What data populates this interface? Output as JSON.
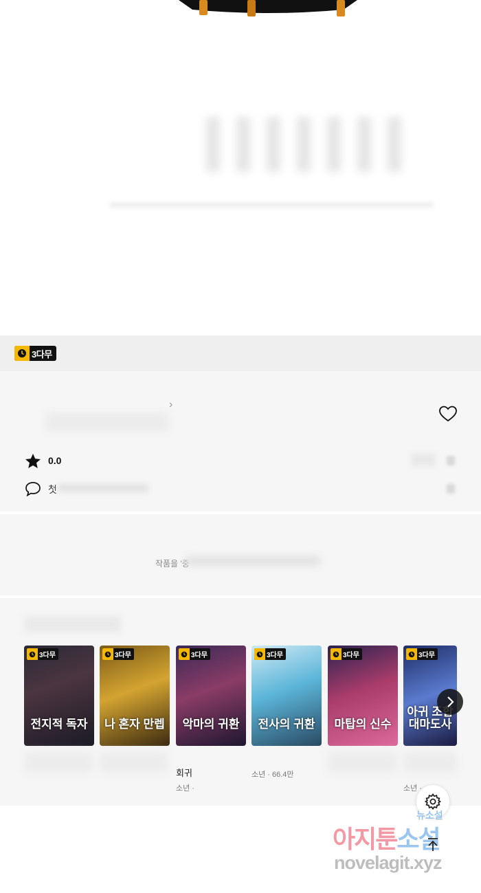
{
  "badge": {
    "label": "3다무",
    "icon": "clock-icon",
    "color": "#f5b800"
  },
  "info": {
    "rating": "0.0",
    "comment_prefix": "첫"
  },
  "works_notice": {
    "text": "작품을 '중"
  },
  "recommendations": {
    "items": [
      {
        "cover_title": "전지적 독자",
        "badge": "3다무"
      },
      {
        "cover_title": "나 혼자 만렙",
        "badge": "3다무"
      },
      {
        "cover_title": "악마의 귀환",
        "badge": "3다무"
      },
      {
        "cover_title": "전사의 귀환",
        "badge": "3다무"
      },
      {
        "cover_title": "마탑의 신수",
        "badge": "3다무"
      },
      {
        "cover_title": "아귀 조합 대마도사",
        "badge": "3다무"
      }
    ],
    "captions": {
      "card3_title": "회귀",
      "card3_meta": "소년 · ",
      "card4_meta": "소년 · 66.4만",
      "card6_meta": "소년 · "
    }
  },
  "watermark": {
    "line1_a": "아지툰",
    "line1_b": "소설",
    "sub": "뉴소설",
    "url": "novelagit.xyz"
  }
}
